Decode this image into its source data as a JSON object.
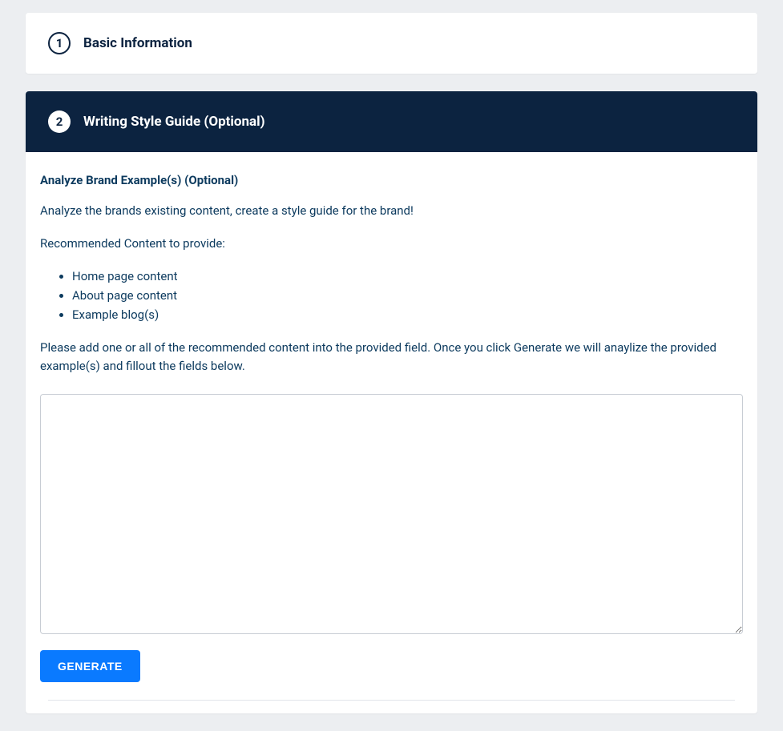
{
  "steps": {
    "step1": {
      "number": "1",
      "title": "Basic Information"
    },
    "step2": {
      "number": "2",
      "title": "Writing Style Guide (Optional)",
      "section_title": "Analyze Brand Example(s) (Optional)",
      "intro_text": "Analyze the brands existing content, create a style guide for the brand!",
      "recommend_label": "Recommended Content to provide:",
      "recommend_items": {
        "0": "Home page content",
        "1": "About page content",
        "2": "Example blog(s)"
      },
      "instruction_text": "Please add one or all of the recommended content into the provided field. Once you click Generate we will anaylize the provided example(s) and fillout the fields below.",
      "textarea_value": "",
      "generate_label": "Generate"
    }
  }
}
